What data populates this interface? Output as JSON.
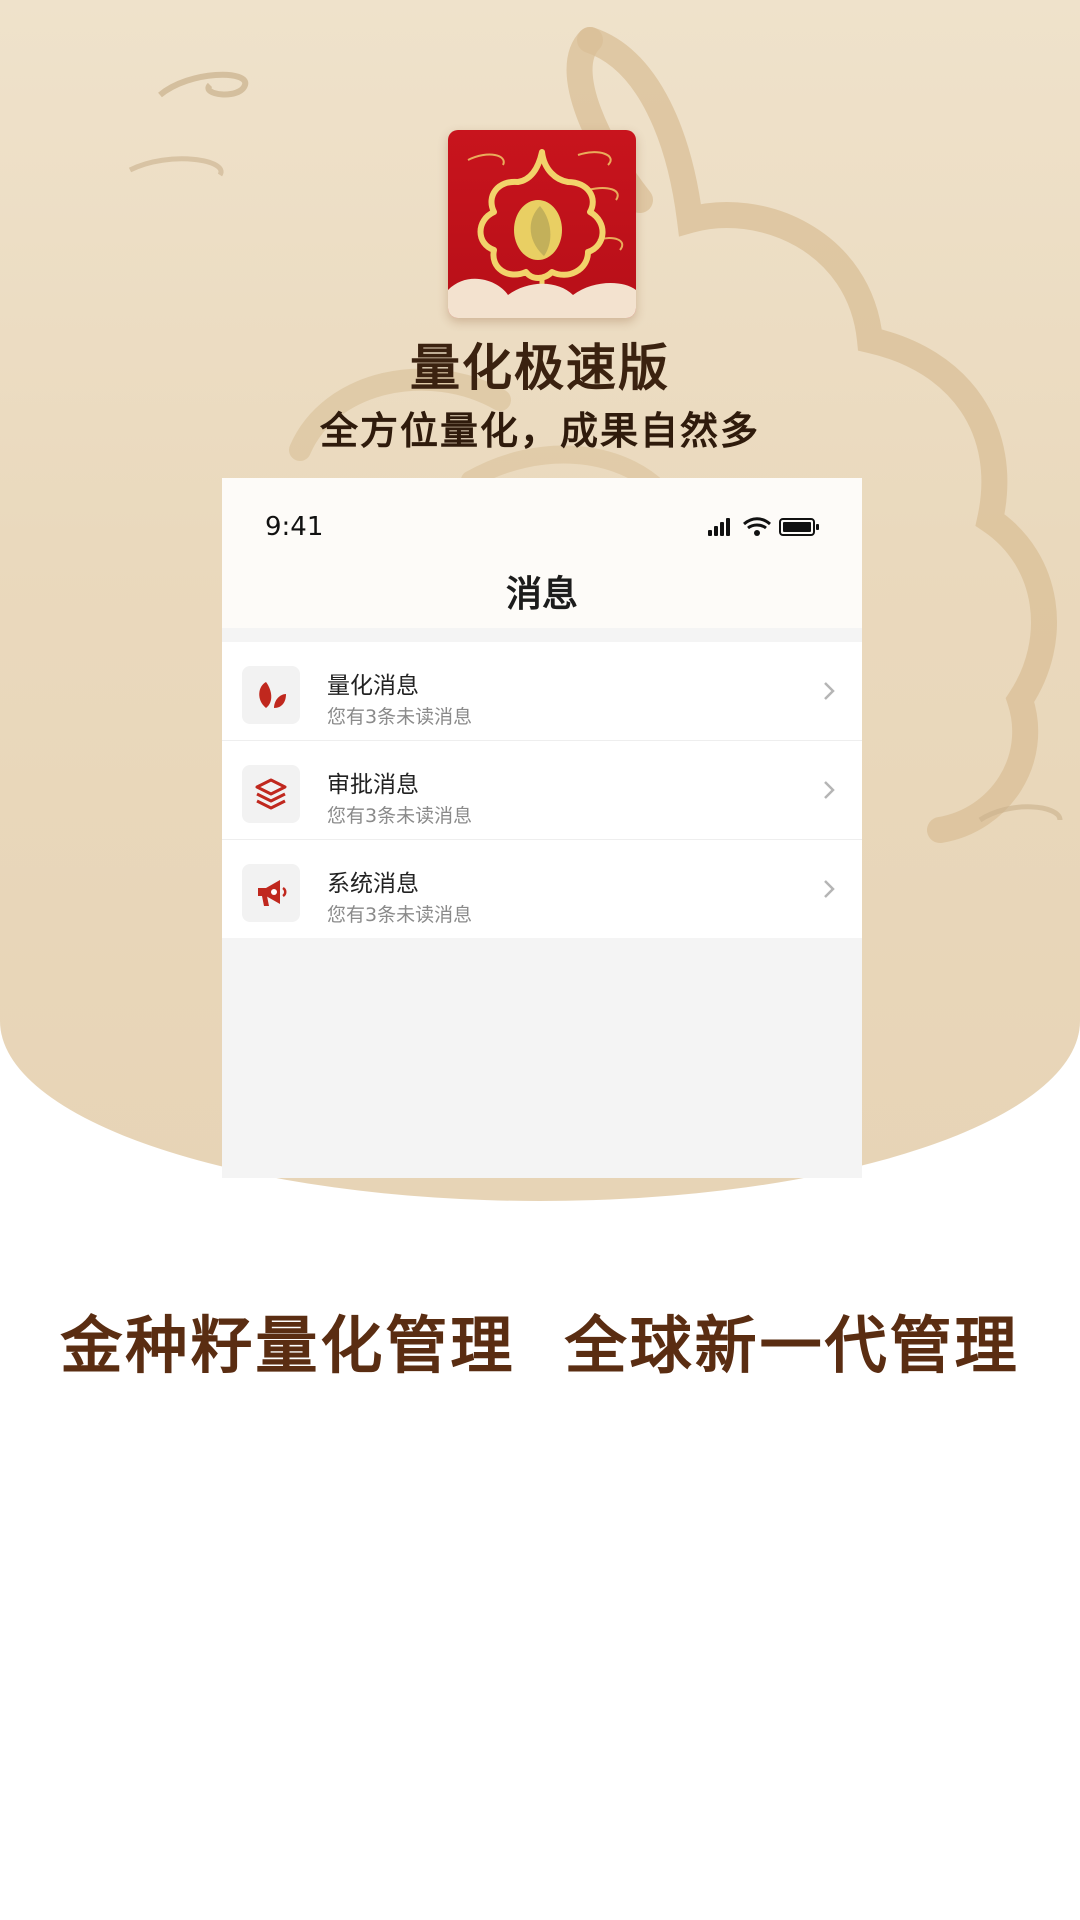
{
  "app": {
    "title": "量化极速版",
    "subtitle": "全方位量化，成果自然多",
    "icon": "golden-seed-logo-icon"
  },
  "phone": {
    "status_time": "9:41",
    "status_icons": [
      "signal-icon",
      "wifi-icon",
      "battery-icon"
    ],
    "nav_title": "消息"
  },
  "messages": [
    {
      "title": "量化消息",
      "subtitle": "您有3条未读消息",
      "icon": "leaves-icon"
    },
    {
      "title": "审批消息",
      "subtitle": "您有3条未读消息",
      "icon": "layers-icon"
    },
    {
      "title": "系统消息",
      "subtitle": "您有3条未读消息",
      "icon": "megaphone-icon"
    }
  ],
  "slogan": "金种籽量化管理  全球新一代管理",
  "colors": {
    "brand_red": "#c8141d",
    "gold": "#f2d36b",
    "heading_brown": "#3b2210",
    "slogan_brown": "#5a2d12",
    "background_beige": "#ead9bd"
  }
}
